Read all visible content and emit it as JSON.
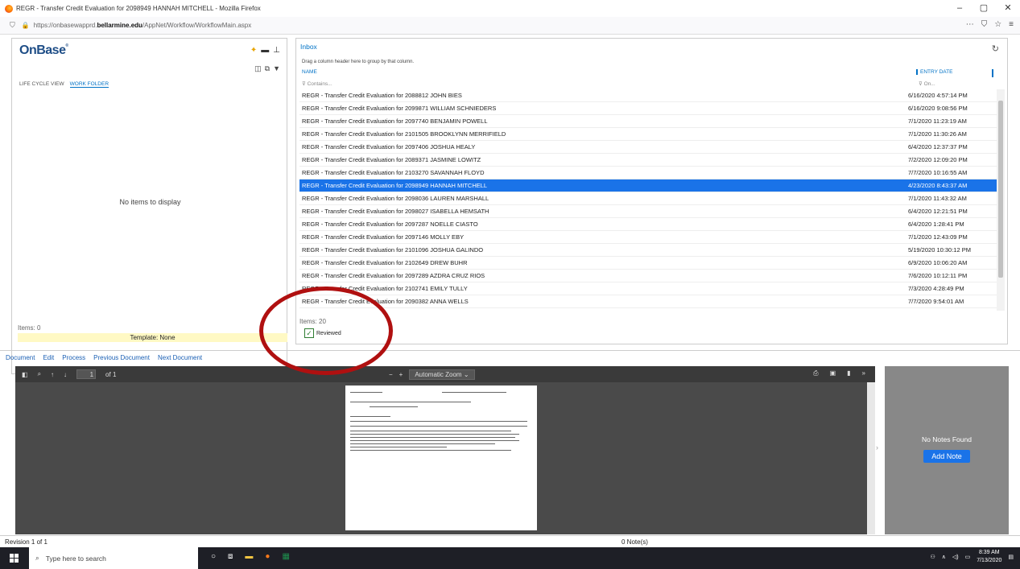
{
  "window": {
    "title": "REGR - Transfer Credit Evaluation for 2098949 HANNAH MITCHELL - Mozilla Firefox",
    "controls": [
      "–",
      "▢",
      "✕"
    ]
  },
  "urlbar": {
    "prefix": "https://onbasewapprd.",
    "domain": "bellarmine.edu",
    "path": "/AppNet/Workflow/WorkflowMain.aspx"
  },
  "leftpane": {
    "logo": "OnBase",
    "tabs": [
      "LIFE CYCLE VIEW",
      "WORK FOLDER"
    ],
    "empty_text": "No items to display",
    "items_count": "Items: 0",
    "template": "Template: None"
  },
  "inbox": {
    "title": "Inbox",
    "group_hint": "Drag a column header here to group by that column.",
    "columns": {
      "name": "NAME",
      "date": "ENTRY DATE"
    },
    "filters": {
      "name": "Contains...",
      "date": "On..."
    },
    "rows": [
      {
        "name": "REGR - Transfer Credit Evaluation for 2088812 JOHN BIES",
        "date": "6/16/2020 4:57:14 PM"
      },
      {
        "name": "REGR - Transfer Credit Evaluation for 2099871 WILLIAM SCHNIEDERS",
        "date": "6/16/2020 9:08:56 PM"
      },
      {
        "name": "REGR - Transfer Credit Evaluation for 2097740 BENJAMIN POWELL",
        "date": "7/1/2020 11:23:19 AM"
      },
      {
        "name": "REGR - Transfer Credit Evaluation for 2101505 BROOKLYNN MERRIFIELD",
        "date": "7/1/2020 11:30:26 AM"
      },
      {
        "name": "REGR - Transfer Credit Evaluation for 2097406 JOSHUA HEALY",
        "date": "6/4/2020 12:37:37 PM"
      },
      {
        "name": "REGR - Transfer Credit Evaluation for 2089371 JASMINE LOWITZ",
        "date": "7/2/2020 12:09:20 PM"
      },
      {
        "name": "REGR - Transfer Credit Evaluation for 2103270 SAVANNAH FLOYD",
        "date": "7/7/2020 10:16:55 AM"
      },
      {
        "name": "REGR - Transfer Credit Evaluation for 2098949 HANNAH MITCHELL",
        "date": "4/23/2020 8:43:37 AM",
        "selected": true
      },
      {
        "name": "REGR - Transfer Credit Evaluation for 2098036 LAUREN MARSHALL",
        "date": "7/1/2020 11:43:32 AM"
      },
      {
        "name": "REGR - Transfer Credit Evaluation for 2098027 ISABELLA HEMSATH",
        "date": "6/4/2020 12:21:51 PM"
      },
      {
        "name": "REGR - Transfer Credit Evaluation for 2097287 NOELLE CIASTO",
        "date": "6/4/2020 1:28:41 PM"
      },
      {
        "name": "REGR - Transfer Credit Evaluation for 2097146 MOLLY EBY",
        "date": "7/1/2020 12:43:09 PM"
      },
      {
        "name": "REGR - Transfer Credit Evaluation for 2101096 JOSHUA GALINDO",
        "date": "5/19/2020 10:30:12 PM"
      },
      {
        "name": "REGR - Transfer Credit Evaluation for 2102649 DREW BUHR",
        "date": "6/9/2020 10:06:20 AM"
      },
      {
        "name": "REGR - Transfer Credit Evaluation for 2097289 AZDRA CRUZ RIOS",
        "date": "7/6/2020 10:12:11 PM"
      },
      {
        "name": "REGR - Transfer Credit Evaluation for 2102741 EMILY TULLY",
        "date": "7/3/2020 4:28:49 PM"
      },
      {
        "name": "REGR - Transfer Credit Evaluation for 2090382 ANNA WELLS",
        "date": "7/7/2020 9:54:01 AM"
      }
    ],
    "items_count": "Items: 20",
    "reviewed_label": "Reviewed"
  },
  "docnav": [
    "Document",
    "Edit",
    "Process",
    "Previous Document",
    "Next Document"
  ],
  "viewer": {
    "page_value": "1",
    "page_total": "of 1",
    "zoom": "Automatic Zoom"
  },
  "notes": {
    "empty": "No Notes Found",
    "add": "Add Note"
  },
  "footer": {
    "revision": "Revision 1 of 1",
    "notes_count": "0 Note(s)"
  },
  "taskbar": {
    "search_placeholder": "Type here to search",
    "time": "8:39 AM",
    "date": "7/13/2020"
  },
  "colors": {
    "selection": "#1a73e8",
    "link": "#0072c6",
    "annotation": "#b01010"
  }
}
